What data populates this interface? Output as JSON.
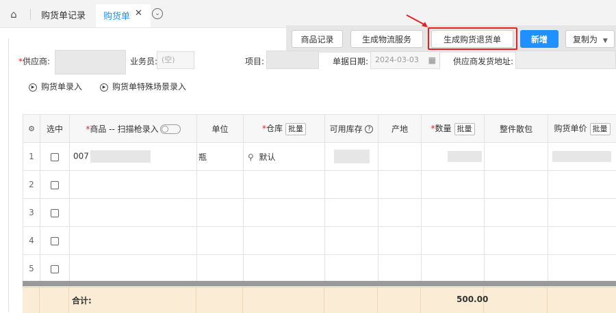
{
  "tabs": {
    "first": "购货单记录",
    "active": "购货单",
    "close": "✕",
    "more": "⌄"
  },
  "toolbar": {
    "product_record": "商品记录",
    "gen_logistics": "生成物流服务",
    "gen_return": "生成购货退货单",
    "new": "新增",
    "copy_as": "复制为"
  },
  "form": {
    "supplier_label": "供应商:",
    "salesman_label": "业务员:",
    "salesman_value": "(空)",
    "project_label": "项目:",
    "date_label": "单据日期:",
    "date_value": "2024-03-03",
    "address_label": "供应商发货地址:"
  },
  "sublinks": {
    "entry": "购货单录入",
    "special_entry": "购货单特殊场景录入"
  },
  "table": {
    "headers": {
      "select": "选中",
      "product": "商品 -- 扫描枪录入",
      "unit": "单位",
      "warehouse": "仓库",
      "batch": "批量",
      "available": "可用库存",
      "origin": "产地",
      "quantity": "数量",
      "pack": "整件散包",
      "price": "购货单价"
    },
    "rows": [
      {
        "no": "1",
        "product": "007",
        "unit": "瓶",
        "warehouse": "默认"
      },
      {
        "no": "2"
      },
      {
        "no": "3"
      },
      {
        "no": "4"
      },
      {
        "no": "5"
      }
    ],
    "total_label": "合计:",
    "total_qty": "500.00"
  },
  "colors": {
    "accent": "#1e90ff",
    "highlight": "#e62020",
    "totals_bg": "#fbedd5"
  }
}
